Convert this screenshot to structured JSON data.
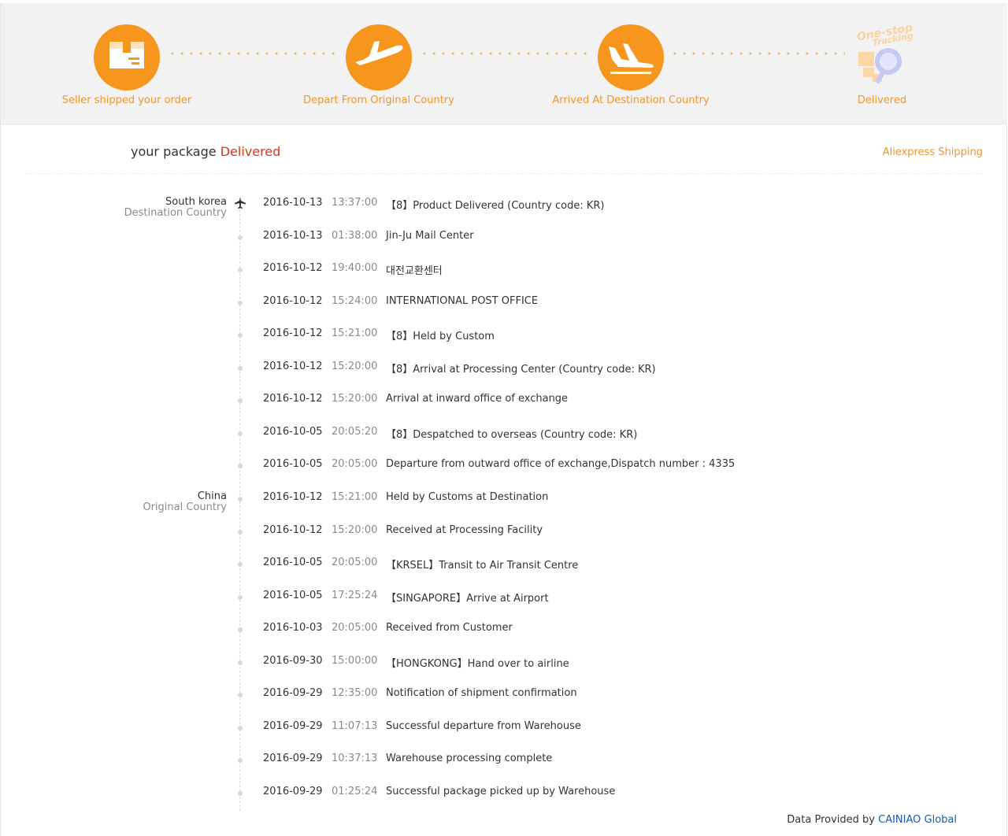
{
  "progress": {
    "steps": [
      {
        "label": "Seller shipped your order",
        "icon": "package-icon"
      },
      {
        "label": "Depart From Original Country",
        "icon": "plane-takeoff-icon"
      },
      {
        "label": "Arrived At Destination Country",
        "icon": "plane-landing-icon"
      },
      {
        "label": "Delivered",
        "icon": "one-stop-tracking-logo"
      }
    ],
    "logo_text": [
      "One-stop",
      "Tracking"
    ]
  },
  "header": {
    "prefix": "your package",
    "status": "Delivered",
    "shipping_link": "Aliexpress Shipping"
  },
  "countries": [
    {
      "name": "South korea",
      "role": "Destination Country"
    },
    {
      "name": "China",
      "role": "Original Country"
    }
  ],
  "events": [
    {
      "date": "2016-10-13",
      "time": "13:37:00",
      "desc": "【8】Product Delivered (Country code: KR)"
    },
    {
      "date": "2016-10-13",
      "time": "01:38:00",
      "desc": "Jin-Ju Mail Center"
    },
    {
      "date": "2016-10-12",
      "time": "19:40:00",
      "desc": "대전교환센터"
    },
    {
      "date": "2016-10-12",
      "time": "15:24:00",
      "desc": "INTERNATIONAL POST OFFICE"
    },
    {
      "date": "2016-10-12",
      "time": "15:21:00",
      "desc": "【8】Held by Custom"
    },
    {
      "date": "2016-10-12",
      "time": "15:20:00",
      "desc": "【8】Arrival at Processing Center (Country code: KR)"
    },
    {
      "date": "2016-10-12",
      "time": "15:20:00",
      "desc": "Arrival at inward office of exchange"
    },
    {
      "date": "2016-10-05",
      "time": "20:05:20",
      "desc": "【8】Despatched to overseas (Country code: KR)"
    },
    {
      "date": "2016-10-05",
      "time": "20:05:00",
      "desc": "Departure from outward office of exchange,Dispatch number : 4335"
    },
    {
      "date": "2016-10-12",
      "time": "15:21:00",
      "desc": "Held by Customs at Destination"
    },
    {
      "date": "2016-10-12",
      "time": "15:20:00",
      "desc": "Received at Processing Facility"
    },
    {
      "date": "2016-10-05",
      "time": "20:05:00",
      "desc": "【KRSEL】Transit to Air Transit Centre"
    },
    {
      "date": "2016-10-05",
      "time": "17:25:24",
      "desc": "【SINGAPORE】Arrive at Airport"
    },
    {
      "date": "2016-10-03",
      "time": "20:05:00",
      "desc": "Received from Customer"
    },
    {
      "date": "2016-09-30",
      "time": "15:00:00",
      "desc": "【HONGKONG】Hand over to airline"
    },
    {
      "date": "2016-09-29",
      "time": "12:35:00",
      "desc": "Notification of shipment confirmation"
    },
    {
      "date": "2016-09-29",
      "time": "11:07:13",
      "desc": "Successful departure from Warehouse"
    },
    {
      "date": "2016-09-29",
      "time": "10:37:13",
      "desc": "Warehouse processing complete"
    },
    {
      "date": "2016-09-29",
      "time": "01:25:24",
      "desc": "Successful package picked up by Warehouse"
    }
  ],
  "footer": {
    "prefix": "Data Provided by",
    "link": "CAINIAO Global"
  },
  "colors": {
    "accent": "#f7961d",
    "status": "#d9381e",
    "link": "#1a5aa6"
  }
}
